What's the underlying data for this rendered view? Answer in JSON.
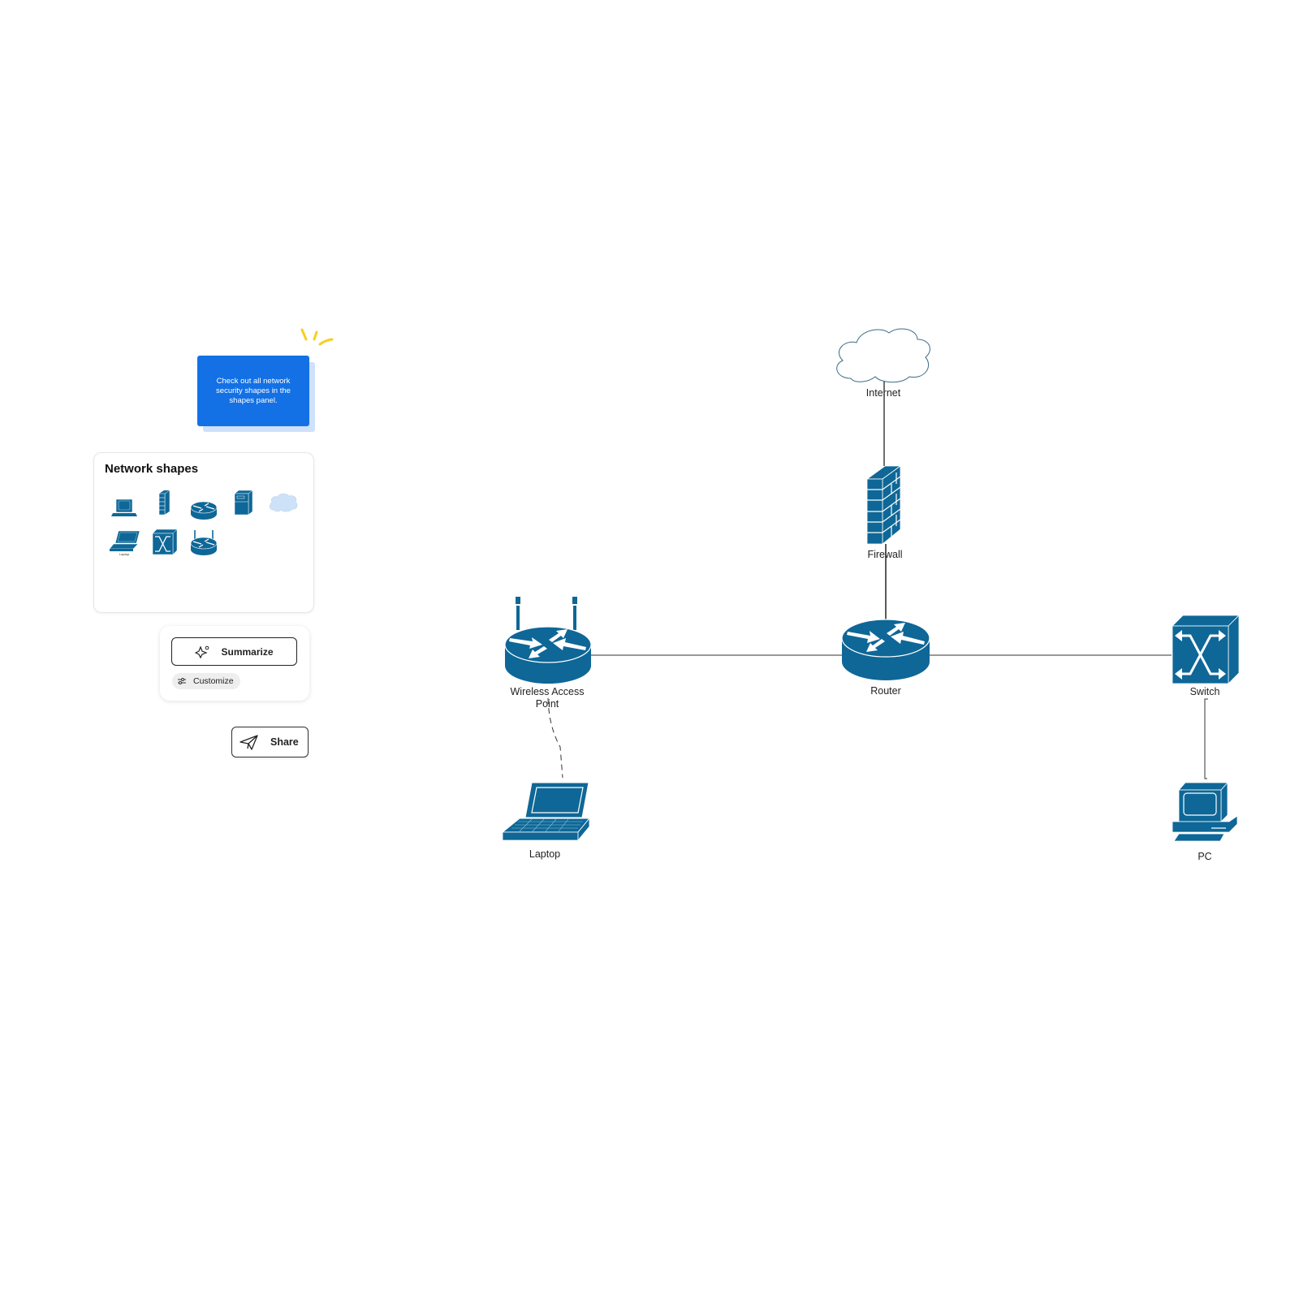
{
  "sticky_note": {
    "text": "Check out all network security shapes in the shapes panel.",
    "color": "#1371e5",
    "accent_color": "#f5d020"
  },
  "shapes_panel": {
    "title": "Network shapes",
    "items": [
      {
        "icon": "pc-icon"
      },
      {
        "icon": "firewall-icon"
      },
      {
        "icon": "router-icon"
      },
      {
        "icon": "server-icon"
      },
      {
        "icon": "cloud-icon"
      },
      {
        "icon": "laptop-icon",
        "caption": "Laptop"
      },
      {
        "icon": "switch-icon"
      },
      {
        "icon": "wireless-access-point-icon"
      }
    ]
  },
  "ai_card": {
    "summarize_label": "Summarize",
    "customize_label": "Customize"
  },
  "share": {
    "label": "Share"
  },
  "diagram": {
    "device_color": "#0e6797",
    "cloud_fill": "#ffffff",
    "nodes": [
      {
        "id": "internet",
        "label": "Internet",
        "type": "cloud"
      },
      {
        "id": "firewall",
        "label": "Firewall",
        "type": "firewall"
      },
      {
        "id": "router",
        "label": "Router",
        "type": "router"
      },
      {
        "id": "wap",
        "label": "Wireless Access Point",
        "label_lines": [
          "Wireless Access",
          "Point"
        ],
        "type": "wireless-access-point"
      },
      {
        "id": "switch",
        "label": "Switch",
        "type": "switch"
      },
      {
        "id": "laptop",
        "label": "Laptop",
        "type": "laptop"
      },
      {
        "id": "pc",
        "label": "PC",
        "type": "pc"
      }
    ],
    "edges": [
      {
        "from": "internet",
        "to": "firewall",
        "style": "solid"
      },
      {
        "from": "firewall",
        "to": "router",
        "style": "solid"
      },
      {
        "from": "wap",
        "to": "router",
        "style": "solid"
      },
      {
        "from": "router",
        "to": "switch",
        "style": "solid"
      },
      {
        "from": "switch",
        "to": "pc",
        "style": "solid"
      },
      {
        "from": "wap",
        "to": "laptop",
        "style": "dashed"
      }
    ]
  }
}
